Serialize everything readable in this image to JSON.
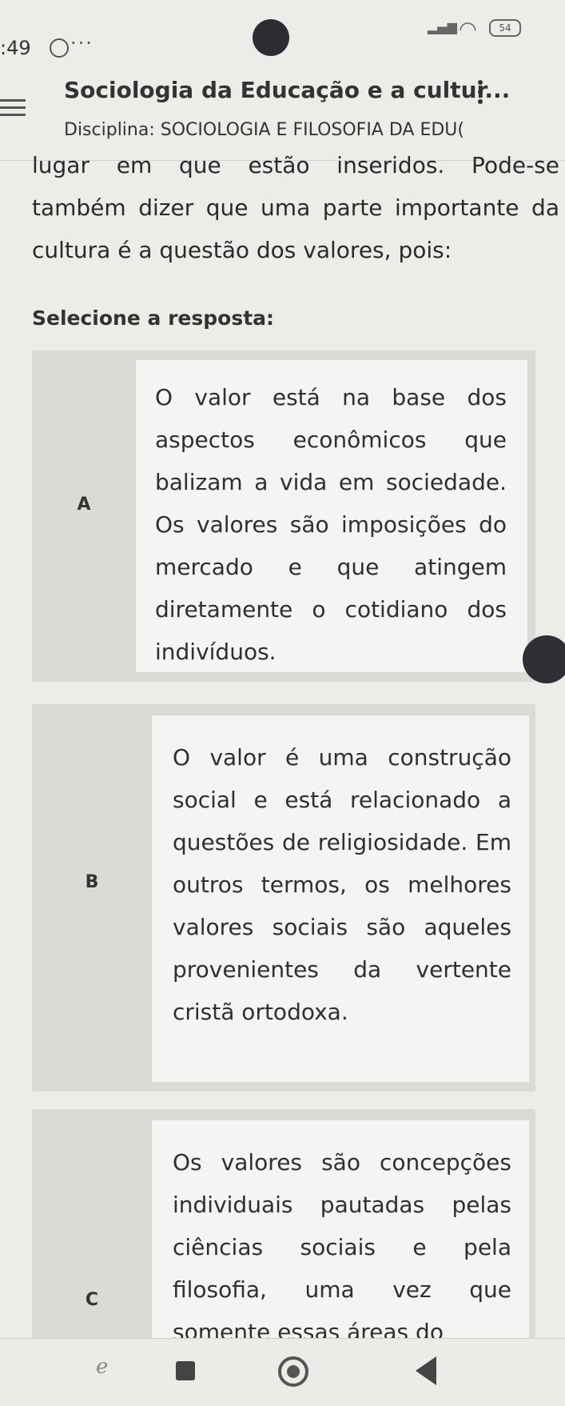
{
  "status_bar": {
    "time": ":49",
    "overflow": "···",
    "battery": "54"
  },
  "app_bar": {
    "title": "Sociologia da Educação e a cultur...",
    "subtitle": "Disciplina: SOCIOLOGIA E FILOSOFIA DA EDU("
  },
  "question": {
    "text": "lugar em que estão inseridos. Pode-se também dizer que uma parte importante da cultura é a questão dos valores, pois:"
  },
  "select_label": "Selecione a resposta:",
  "options": [
    {
      "letter": "A",
      "text": "O valor está na base dos aspectos econômicos que balizam a vida em sociedade. Os valores são imposições do mercado e que atingem diretamente o cotidiano dos indivíduos."
    },
    {
      "letter": "B",
      "text": "O valor é uma construção social e está relacionado a questões de religiosidade. Em outros termos, os melhores valores sociais são aqueles provenientes da vertente cristã ortodoxa."
    },
    {
      "letter": "C",
      "text": "Os valores são concepções individuais pautadas pelas ciências sociais e pela filosofia, uma vez que somente essas áreas do"
    }
  ]
}
